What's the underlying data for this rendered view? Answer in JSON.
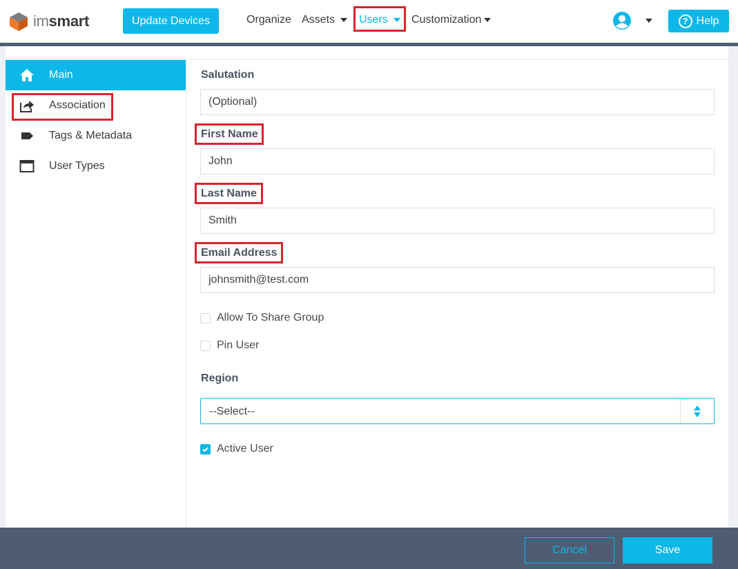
{
  "navbar": {
    "logo_im": "im",
    "logo_smart": "smart",
    "update_devices": "Update Devices",
    "links": [
      "Organize",
      "Assets",
      "Users",
      "Customization"
    ],
    "help": "Help",
    "accent_color": "#0db7e8",
    "highlight_color": "#d9232d"
  },
  "sidebar": {
    "items": [
      {
        "label": "Main",
        "icon": "home-icon",
        "active": true
      },
      {
        "label": "Association",
        "icon": "share-icon"
      },
      {
        "label": "Tags & Metadata",
        "icon": "tag-icon"
      },
      {
        "label": "User Types",
        "icon": "window-icon"
      }
    ]
  },
  "form": {
    "salutation": {
      "label": "Salutation",
      "placeholder": "(Optional)",
      "value": ""
    },
    "first_name": {
      "label": "First Name",
      "value": "John"
    },
    "last_name": {
      "label": "Last Name",
      "value": "Smith"
    },
    "email": {
      "label": "Email Address",
      "value": "johnsmith@test.com"
    },
    "allow_share": {
      "label": "Allow To Share Group",
      "checked": false
    },
    "pin_user": {
      "label": "Pin User",
      "checked": false
    },
    "region": {
      "label": "Region",
      "selected": "--Select--"
    },
    "active_user": {
      "label": "Active User",
      "checked": true
    }
  },
  "footer": {
    "cancel": "Cancel",
    "save": "Save"
  }
}
